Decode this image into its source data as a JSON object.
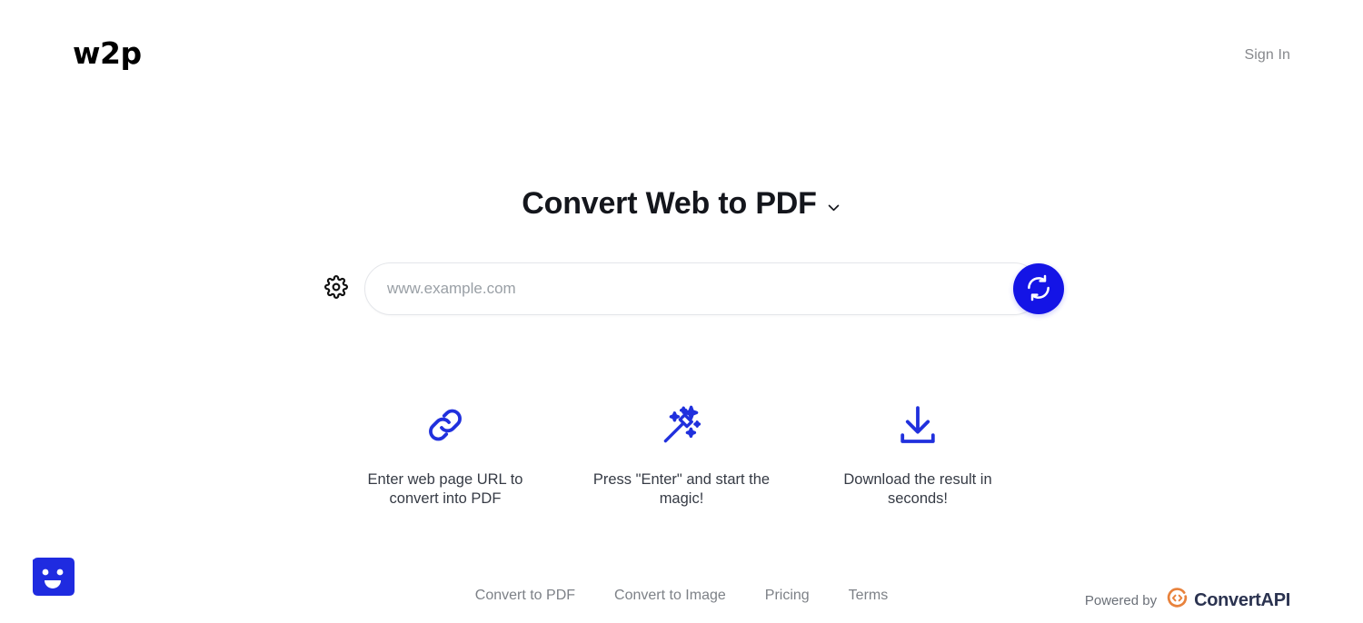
{
  "header": {
    "logo_text": "w2p",
    "signin_label": "Sign In"
  },
  "hero": {
    "title": "Convert Web to PDF",
    "dropdown_icon": "chevron-down-icon"
  },
  "search": {
    "settings_icon": "gear-icon",
    "placeholder": "www.example.com",
    "value": "",
    "convert_icon": "refresh-convert-icon",
    "convert_button_color": "#1414e6"
  },
  "features": [
    {
      "icon": "link-chain-icon",
      "caption": "Enter web page URL to convert into PDF",
      "color": "#2030dd"
    },
    {
      "icon": "magic-wand-icon",
      "caption": "Press \"Enter\" and start the magic!",
      "color": "#2030dd"
    },
    {
      "icon": "download-icon",
      "caption": "Download the result in seconds!",
      "color": "#2030dd"
    }
  ],
  "footer": {
    "links": [
      {
        "label": "Convert to PDF"
      },
      {
        "label": "Convert to Image"
      },
      {
        "label": "Pricing"
      },
      {
        "label": "Terms"
      }
    ],
    "powered_by_label": "Powered by",
    "brand_name": "ConvertAPI",
    "brand_mark_icon": "convertapi-code-circle-icon",
    "brand_mark_color": "#e8823c",
    "brand_text_color": "#2b3350"
  },
  "chat": {
    "icon": "chat-smiley-icon",
    "color": "#1f2be0"
  }
}
